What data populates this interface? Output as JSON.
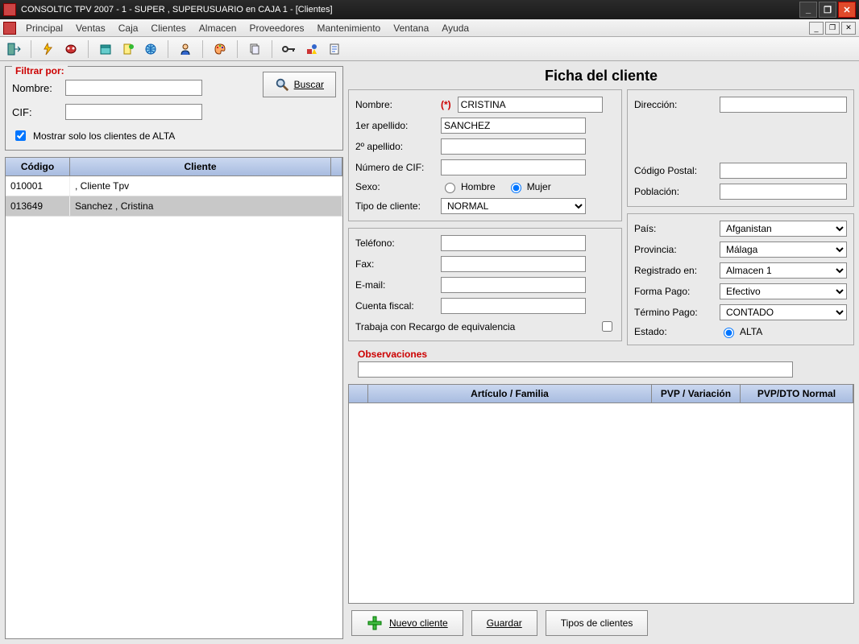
{
  "window": {
    "title": "CONSOLTIC TPV 2007 - 1 - SUPER , SUPERUSUARIO  en CAJA 1 - [Clientes]"
  },
  "menu": {
    "items": [
      "Principal",
      "Ventas",
      "Caja",
      "Clientes",
      "Almacen",
      "Proveedores",
      "Mantenimiento",
      "Ventana",
      "Ayuda"
    ]
  },
  "filter": {
    "legend": "Filtrar por:",
    "nombre_label": "Nombre:",
    "nombre_value": "",
    "cif_label": "CIF:",
    "cif_value": "",
    "buscar_label": "Buscar",
    "alta_checkbox_label": "Mostrar solo los clientes de ALTA",
    "alta_checked": true
  },
  "clientgrid": {
    "headers": {
      "codigo": "Código",
      "cliente": "Cliente"
    },
    "rows": [
      {
        "codigo": "010001",
        "cliente": ", Cliente Tpv",
        "selected": false
      },
      {
        "codigo": "013649",
        "cliente": "Sanchez , Cristina",
        "selected": true
      }
    ]
  },
  "ficha": {
    "title": "Ficha del cliente",
    "labels": {
      "nombre": "Nombre:",
      "ape1": "1er apellido:",
      "ape2": "2º apellido:",
      "cif": "Número de CIF:",
      "sexo": "Sexo:",
      "hombre": "Hombre",
      "mujer": "Mujer",
      "tipo": "Tipo de cliente:",
      "telefono": "Teléfono:",
      "fax": "Fax:",
      "email": "E-mail:",
      "cuenta": "Cuenta fiscal:",
      "recargo": "Trabaja con Recargo de equivalencia",
      "direccion": "Dirección:",
      "cp": "Código Postal:",
      "poblacion": "Población:",
      "pais": "País:",
      "provincia": "Provincia:",
      "registrado": "Registrado en:",
      "formapago": "Forma Pago:",
      "terminopago": "Término Pago:",
      "estado": "Estado:",
      "alta": "ALTA",
      "observaciones": "Observaciones",
      "required": "(*)"
    },
    "values": {
      "nombre": "CRISTINA",
      "ape1": "SANCHEZ",
      "ape2": "",
      "cif": "",
      "sexo": "Mujer",
      "tipo": "NORMAL",
      "telefono": "",
      "fax": "",
      "email": "",
      "cuenta": "",
      "recargo": false,
      "direccion": "",
      "cp": "",
      "poblacion": "",
      "pais": "Afganistan",
      "provincia": "Málaga",
      "registrado": "Almacen 1",
      "formapago": "Efectivo",
      "terminopago": "CONTADO",
      "estado": "ALTA",
      "observaciones": ""
    }
  },
  "articlegrid": {
    "headers": {
      "col1": "",
      "articulo": "Artículo / Familia",
      "pvp": "PVP / Variación",
      "dto": "PVP/DTO Normal"
    }
  },
  "actions": {
    "nuevo": "Nuevo cliente",
    "guardar": "Guardar",
    "tipos": "Tipos de clientes"
  }
}
